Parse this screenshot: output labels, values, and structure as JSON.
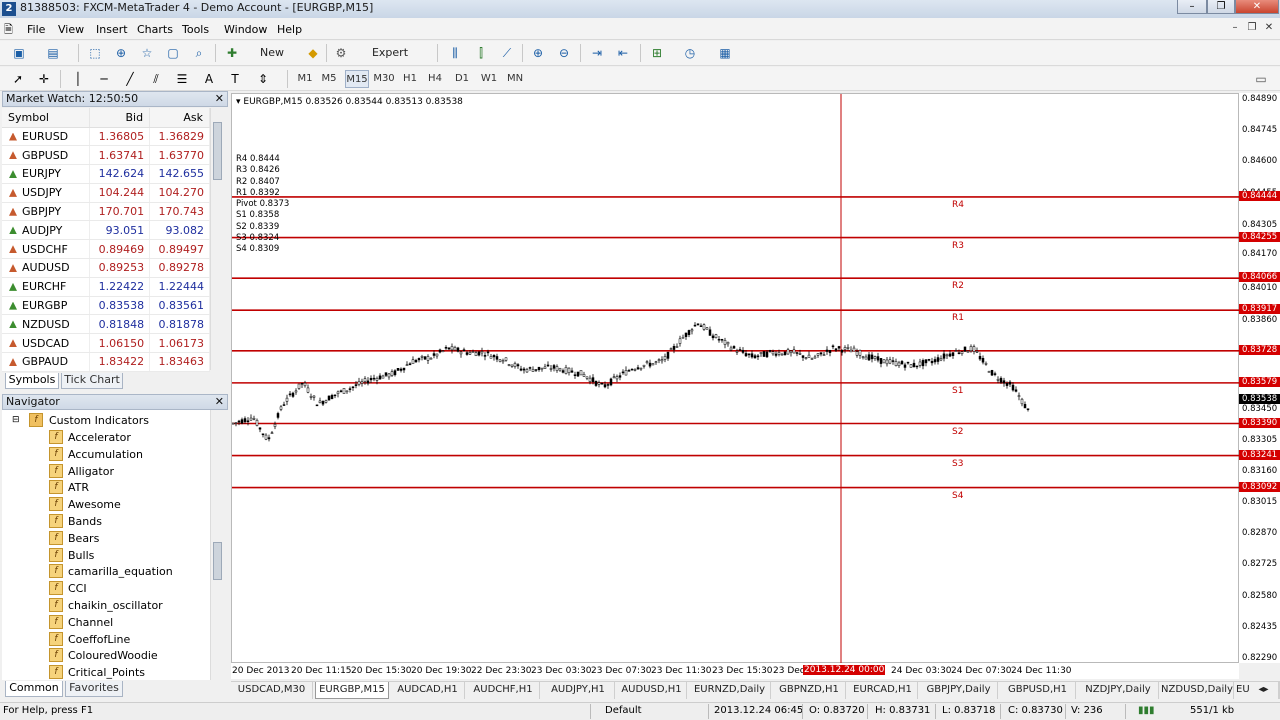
{
  "window": {
    "title": "81388503: FXCM-MetaTrader 4 - Demo Account - [EURGBP,M15]",
    "controls": [
      "–",
      "❐",
      "✕"
    ]
  },
  "menu": [
    "File",
    "View",
    "Insert",
    "Charts",
    "Tools",
    "Window",
    "Help"
  ],
  "toolbar": {
    "new_order": "New Order",
    "expert_advisors": "Expert Advisors",
    "timeframes": [
      "M1",
      "M5",
      "M15",
      "M30",
      "H1",
      "H4",
      "D1",
      "W1",
      "MN"
    ],
    "active_timeframe": "M15"
  },
  "market_watch": {
    "title": "Market Watch: 12:50:50",
    "columns": [
      "Symbol",
      "Bid",
      "Ask"
    ],
    "rows": [
      {
        "symbol": "EURUSD",
        "bid": "1.36805",
        "ask": "1.36829",
        "dir": "up"
      },
      {
        "symbol": "GBPUSD",
        "bid": "1.63741",
        "ask": "1.63770",
        "dir": "up"
      },
      {
        "symbol": "EURJPY",
        "bid": "142.624",
        "ask": "142.655",
        "dir": "down"
      },
      {
        "symbol": "USDJPY",
        "bid": "104.244",
        "ask": "104.270",
        "dir": "up"
      },
      {
        "symbol": "GBPJPY",
        "bid": "170.701",
        "ask": "170.743",
        "dir": "up"
      },
      {
        "symbol": "AUDJPY",
        "bid": "93.051",
        "ask": "93.082",
        "dir": "down"
      },
      {
        "symbol": "USDCHF",
        "bid": "0.89469",
        "ask": "0.89497",
        "dir": "up"
      },
      {
        "symbol": "AUDUSD",
        "bid": "0.89253",
        "ask": "0.89278",
        "dir": "up"
      },
      {
        "symbol": "EURCHF",
        "bid": "1.22422",
        "ask": "1.22444",
        "dir": "down"
      },
      {
        "symbol": "EURGBP",
        "bid": "0.83538",
        "ask": "0.83561",
        "dir": "down"
      },
      {
        "symbol": "NZDUSD",
        "bid": "0.81848",
        "ask": "0.81878",
        "dir": "down"
      },
      {
        "symbol": "USDCAD",
        "bid": "1.06150",
        "ask": "1.06173",
        "dir": "up"
      },
      {
        "symbol": "GBPAUD",
        "bid": "1.83422",
        "ask": "1.83463",
        "dir": "up"
      }
    ],
    "tabs": [
      "Symbols",
      "Tick Chart"
    ]
  },
  "navigator": {
    "title": "Navigator",
    "folder": "Custom Indicators",
    "items": [
      "Accelerator",
      "Accumulation",
      "Alligator",
      "ATR",
      "Awesome",
      "Bands",
      "Bears",
      "Bulls",
      "camarilla_equation",
      "CCI",
      "chaikin_oscillator",
      "Channel",
      "CoeffofLine",
      "ColouredWoodie",
      "Critical_Points"
    ],
    "tabs": [
      "Common",
      "Favorites"
    ]
  },
  "chart": {
    "header": "EURGBP,M15  0.83526 0.83544 0.83513 0.83538",
    "pivot_text": [
      "R4 0.8444",
      "R3 0.8426",
      "R2 0.8407",
      "R1 0.8392",
      "Pivot 0.8373",
      "S1 0.8358",
      "S2 0.8339",
      "S3 0.8324",
      "S4 0.8309"
    ],
    "price_scale": [
      "0.84890",
      "0.84745",
      "0.84600",
      "0.84455",
      "0.84305",
      "0.84170",
      "0.84010",
      "0.83860",
      "0.83715",
      "0.83565",
      "0.83450",
      "0.83305",
      "0.83160",
      "0.83015",
      "0.82870",
      "0.82725",
      "0.82580",
      "0.82435",
      "0.82290"
    ],
    "levels": [
      {
        "name": "R4",
        "value": "0.84444"
      },
      {
        "name": "R3",
        "value": "0.84255"
      },
      {
        "name": "R2",
        "value": "0.84066"
      },
      {
        "name": "R1",
        "value": "0.83917"
      },
      {
        "name": "",
        "value": "0.83728"
      },
      {
        "name": "S1",
        "value": "0.83579"
      },
      {
        "name": "S2",
        "value": "0.83390"
      },
      {
        "name": "S3",
        "value": "0.83241"
      },
      {
        "name": "S4",
        "value": "0.83092"
      }
    ],
    "current_price": "0.83538",
    "time_labels": [
      "20 Dec 2013",
      "20 Dec 11:15",
      "20 Dec 15:30",
      "20 Dec 19:30",
      "22 Dec 23:30",
      "23 Dec 03:30",
      "23 Dec 07:30",
      "23 Dec 11:30",
      "23 Dec 15:30",
      "23 Dec",
      "24 Dec 03:30",
      "24 Dec 07:30",
      "24 Dec 11:30"
    ],
    "crosshair_time": "2013.12.24 00:00",
    "line_color": "#c00000"
  },
  "chart_tabs": [
    "USDCAD,M30",
    "EURGBP,M15",
    "AUDCAD,H1",
    "AUDCHF,H1",
    "AUDJPY,H1",
    "AUDUSD,H1",
    "EURNZD,Daily",
    "GBPNZD,H1",
    "EURCAD,H1",
    "GBPJPY,Daily",
    "GBPUSD,H1",
    "NZDJPY,Daily",
    "NZDUSD,Daily",
    "EURAUD,Daily"
  ],
  "active_chart_tab": "EURGBP,M15",
  "status": {
    "help": "For Help, press F1",
    "profile": "Default",
    "datetime": "2013.12.24 06:45",
    "open": "O: 0.83720",
    "high": "H: 0.83731",
    "low": "L: 0.83718",
    "close": "C: 0.83730",
    "volume": "V: 236",
    "traffic": "551/1 kb"
  }
}
